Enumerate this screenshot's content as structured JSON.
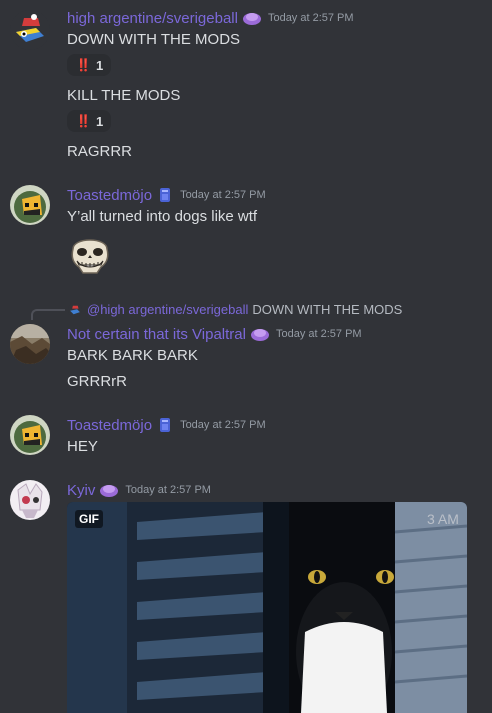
{
  "messages": [
    {
      "username": "high argentine/sverigeball",
      "timestamp": "Today at 2:57 PM",
      "lines": [
        "DOWN WITH THE MODS",
        "KILL THE MODS",
        "RAGRRR"
      ],
      "reactions": [
        {
          "emoji": "‼️",
          "count": "1"
        },
        {
          "emoji": "‼️",
          "count": "1"
        }
      ]
    },
    {
      "username": "Toastedmöjo",
      "timestamp": "Today at 2:57 PM",
      "lines": [
        "Y’all turned into dogs like wtf"
      ],
      "sticker": "troll-skull-sticker"
    },
    {
      "reply": {
        "username": "@high argentine/sverigeball",
        "text": "DOWN WITH THE MODS"
      },
      "username": "Not certain that its Vipaltral",
      "timestamp": "Today at 2:57 PM",
      "lines": [
        "BARK BARK BARK",
        "GRRRrR"
      ]
    },
    {
      "username": "Toastedmöjo",
      "timestamp": "Today at 2:57 PM",
      "lines": [
        "HEY"
      ]
    },
    {
      "username": "Kyiv",
      "timestamp": "Today at 2:57 PM",
      "gif": {
        "label": "GIF",
        "overlay_text": "3 AM"
      }
    }
  ],
  "colors": {
    "username": "#7b68d9",
    "background": "#313338",
    "text": "#dbdee1",
    "timestamp": "#949ba4"
  }
}
